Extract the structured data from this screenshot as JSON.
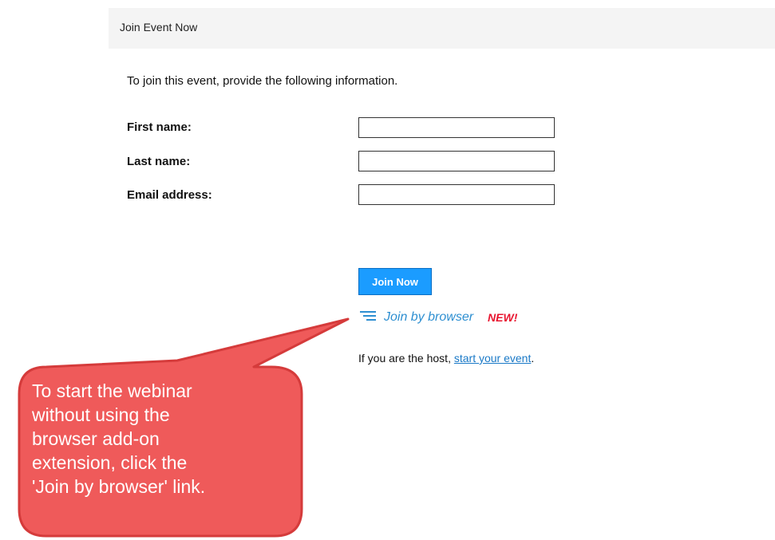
{
  "header": {
    "title": "Join Event Now"
  },
  "intro_text": "To join this event, provide the following information.",
  "form": {
    "first_name_label": "First name:",
    "last_name_label": "Last name:",
    "email_label": "Email address:",
    "first_name_value": "",
    "last_name_value": "",
    "email_value": ""
  },
  "actions": {
    "join_now_label": "Join Now",
    "join_browser_label": "Join by browser",
    "new_badge": "NEW!"
  },
  "host": {
    "prefix": "If you are the host, ",
    "link_text": "start your event",
    "suffix": "."
  },
  "callout": {
    "lines": [
      "To start the webinar",
      "without using the",
      "browser add-on",
      "extension, click the",
      "'Join by browser' link."
    ]
  },
  "colors": {
    "button_bg": "#1b9cff",
    "link": "#2e8fd1",
    "badge": "#e8142f",
    "callout_fill": "#ef5a5a",
    "callout_stroke": "#d53b3b"
  }
}
